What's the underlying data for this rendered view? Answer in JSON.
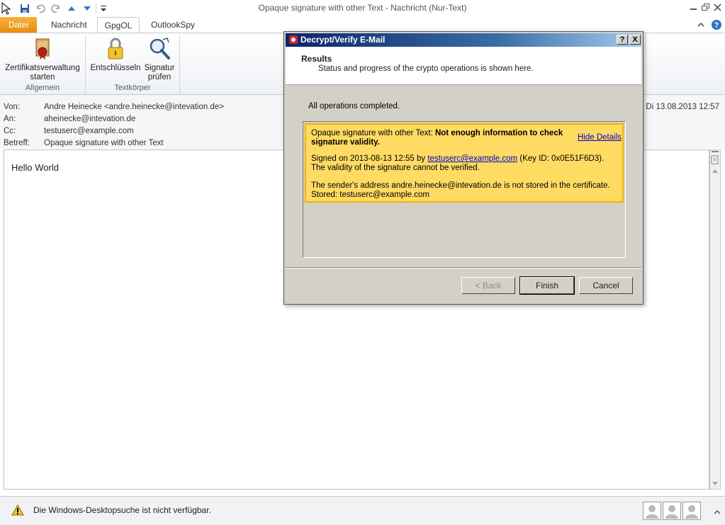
{
  "window": {
    "title": "Opaque signature with other Text  -  Nachricht (Nur-Text)"
  },
  "quick_access": {
    "icons": [
      "cursor-icon",
      "save-icon",
      "undo-icon",
      "redo-icon",
      "previous-item-icon",
      "next-item-icon",
      "customize-dropdown-icon"
    ]
  },
  "tabs": [
    "Datei",
    "Nachricht",
    "GpgOL",
    "OutlookSpy"
  ],
  "ribbon": {
    "groups": {
      "allgemein": "Allgemein",
      "textkoerper": "Textkörper"
    },
    "buttons": {
      "certs_line1": "Zertifikatsverwaltung",
      "certs_line2": "starten",
      "decrypt": "Entschlüsseln",
      "verify_line1": "Signatur",
      "verify_line2": "prüfen"
    }
  },
  "headers": {
    "from_label": "Von:",
    "from_value": "Andre Heinecke <andre.heinecke@intevation.de>",
    "to_label": "An:",
    "to_value": "aheinecke@intevation.de",
    "cc_label": "Cc:",
    "cc_value": "testuserc@example.com",
    "subject_label": "Betreff:",
    "subject_value": "Opaque signature with other Text",
    "date": "Di 13.08.2013 12:57"
  },
  "message": {
    "body": "Hello World"
  },
  "statusbar": {
    "text": "Die Windows-Desktopsuche ist nicht verfügbar."
  },
  "dialog": {
    "title": "Decrypt/Verify E-Mail",
    "help_btn": "?",
    "close_btn": "X",
    "header_title": "Results",
    "header_subtitle": "Status and progress of the crypto operations is shown here.",
    "status": "All operations completed.",
    "result": {
      "prefix": "Opaque signature with other Text: ",
      "bold_line1": "Not enough information to check",
      "bold_line2": "signature validity.",
      "hide_details": "Hide Details",
      "signed_prefix": "Signed on 2013-08-13 12:55 by ",
      "signer_link": "testuserc@example.com",
      "key_id": " (Key ID: 0x0E51F6D3).",
      "validity": "The validity of the signature cannot be verified.",
      "sender_line": "The sender's address andre.heinecke@intevation.de is not stored in the certificate.",
      "stored_line": "Stored: testuserc@example.com"
    },
    "buttons": {
      "back": "< Back",
      "finish": "Finish",
      "cancel": "Cancel"
    }
  }
}
